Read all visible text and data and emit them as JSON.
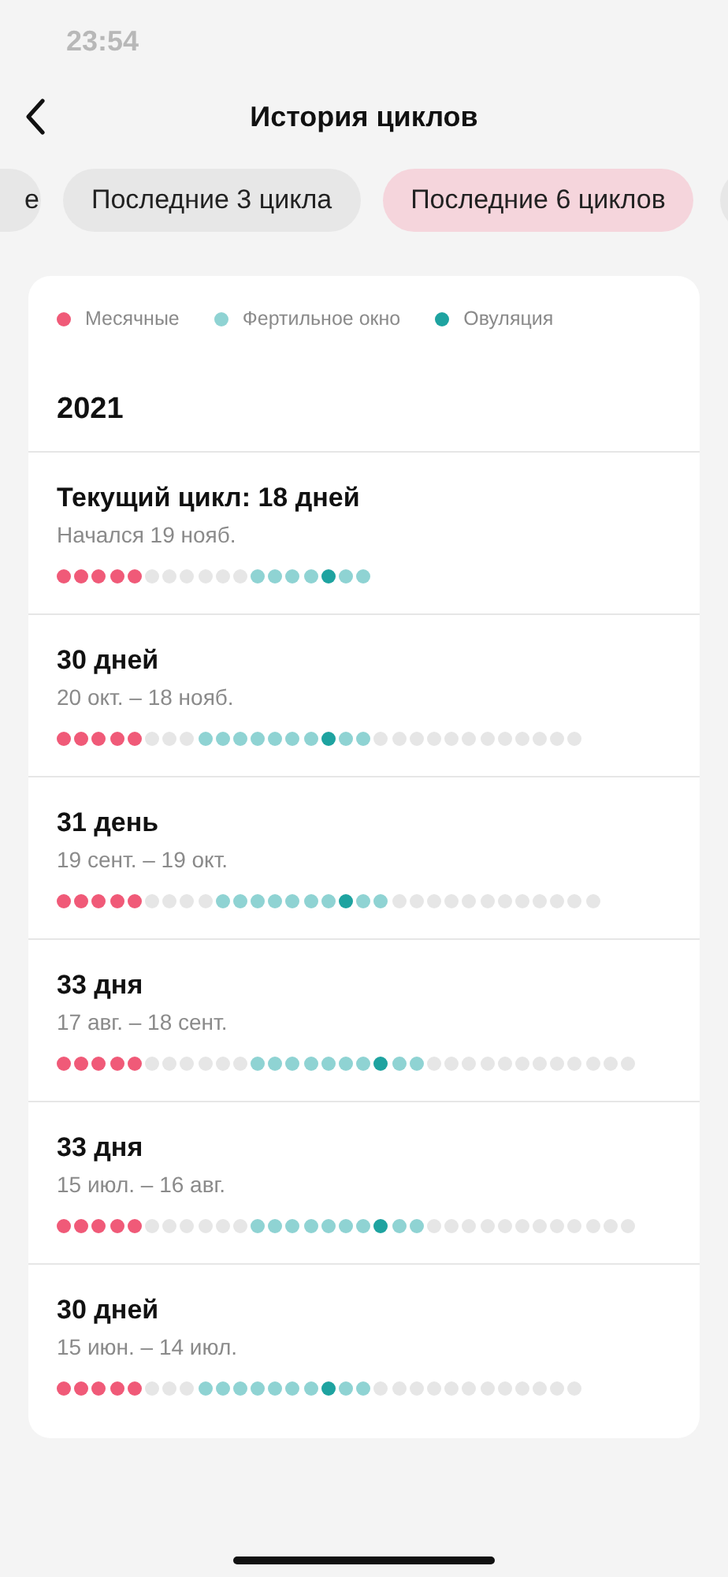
{
  "status_bar": {
    "time": "23:54"
  },
  "header": {
    "title": "История циклов"
  },
  "filters": [
    {
      "label": "е",
      "selected": false
    },
    {
      "label": "Последние 3 цикла",
      "selected": false
    },
    {
      "label": "Последние 6 циклов",
      "selected": true
    }
  ],
  "legend": [
    {
      "label": "Месячные",
      "color": "#f05a78"
    },
    {
      "label": "Фертильное окно",
      "color": "#8fd3d3"
    },
    {
      "label": "Овуляция",
      "color": "#1ea3a0"
    }
  ],
  "year": "2021",
  "cycles": [
    {
      "title": "Текущий цикл: 18 дней",
      "dates": "Начался 19 нояб.",
      "days": [
        {
          "kind": "period"
        },
        {
          "kind": "period"
        },
        {
          "kind": "period"
        },
        {
          "kind": "period"
        },
        {
          "kind": "period"
        },
        {
          "kind": "none"
        },
        {
          "kind": "none"
        },
        {
          "kind": "none"
        },
        {
          "kind": "none"
        },
        {
          "kind": "none"
        },
        {
          "kind": "none"
        },
        {
          "kind": "fertile"
        },
        {
          "kind": "fertile"
        },
        {
          "kind": "fertile"
        },
        {
          "kind": "fertile"
        },
        {
          "kind": "ovulation"
        },
        {
          "kind": "fertile"
        },
        {
          "kind": "fertile"
        }
      ]
    },
    {
      "title": "30 дней",
      "dates": "20 окт. – 18 нояб.",
      "days": [
        {
          "kind": "period"
        },
        {
          "kind": "period"
        },
        {
          "kind": "period"
        },
        {
          "kind": "period"
        },
        {
          "kind": "period"
        },
        {
          "kind": "none"
        },
        {
          "kind": "none"
        },
        {
          "kind": "none"
        },
        {
          "kind": "fertile"
        },
        {
          "kind": "fertile"
        },
        {
          "kind": "fertile"
        },
        {
          "kind": "fertile"
        },
        {
          "kind": "fertile"
        },
        {
          "kind": "fertile"
        },
        {
          "kind": "fertile"
        },
        {
          "kind": "ovulation"
        },
        {
          "kind": "fertile"
        },
        {
          "kind": "fertile"
        },
        {
          "kind": "none"
        },
        {
          "kind": "none"
        },
        {
          "kind": "none"
        },
        {
          "kind": "none"
        },
        {
          "kind": "none"
        },
        {
          "kind": "none"
        },
        {
          "kind": "none"
        },
        {
          "kind": "none"
        },
        {
          "kind": "none"
        },
        {
          "kind": "none"
        },
        {
          "kind": "none"
        },
        {
          "kind": "none"
        }
      ]
    },
    {
      "title": "31 день",
      "dates": "19 сент. – 19 окт.",
      "days": [
        {
          "kind": "period"
        },
        {
          "kind": "period"
        },
        {
          "kind": "period"
        },
        {
          "kind": "period"
        },
        {
          "kind": "period"
        },
        {
          "kind": "none"
        },
        {
          "kind": "none"
        },
        {
          "kind": "none"
        },
        {
          "kind": "none"
        },
        {
          "kind": "fertile"
        },
        {
          "kind": "fertile"
        },
        {
          "kind": "fertile"
        },
        {
          "kind": "fertile"
        },
        {
          "kind": "fertile"
        },
        {
          "kind": "fertile"
        },
        {
          "kind": "fertile"
        },
        {
          "kind": "ovulation"
        },
        {
          "kind": "fertile"
        },
        {
          "kind": "fertile"
        },
        {
          "kind": "none"
        },
        {
          "kind": "none"
        },
        {
          "kind": "none"
        },
        {
          "kind": "none"
        },
        {
          "kind": "none"
        },
        {
          "kind": "none"
        },
        {
          "kind": "none"
        },
        {
          "kind": "none"
        },
        {
          "kind": "none"
        },
        {
          "kind": "none"
        },
        {
          "kind": "none"
        },
        {
          "kind": "none"
        }
      ]
    },
    {
      "title": "33 дня",
      "dates": "17 авг. – 18 сент.",
      "days": [
        {
          "kind": "period"
        },
        {
          "kind": "period"
        },
        {
          "kind": "period"
        },
        {
          "kind": "period"
        },
        {
          "kind": "period"
        },
        {
          "kind": "none"
        },
        {
          "kind": "none"
        },
        {
          "kind": "none"
        },
        {
          "kind": "none"
        },
        {
          "kind": "none"
        },
        {
          "kind": "none"
        },
        {
          "kind": "fertile"
        },
        {
          "kind": "fertile"
        },
        {
          "kind": "fertile"
        },
        {
          "kind": "fertile"
        },
        {
          "kind": "fertile"
        },
        {
          "kind": "fertile"
        },
        {
          "kind": "fertile"
        },
        {
          "kind": "ovulation"
        },
        {
          "kind": "fertile"
        },
        {
          "kind": "fertile"
        },
        {
          "kind": "none"
        },
        {
          "kind": "none"
        },
        {
          "kind": "none"
        },
        {
          "kind": "none"
        },
        {
          "kind": "none"
        },
        {
          "kind": "none"
        },
        {
          "kind": "none"
        },
        {
          "kind": "none"
        },
        {
          "kind": "none"
        },
        {
          "kind": "none"
        },
        {
          "kind": "none"
        },
        {
          "kind": "none"
        }
      ]
    },
    {
      "title": "33 дня",
      "dates": "15 июл. – 16 авг.",
      "days": [
        {
          "kind": "period"
        },
        {
          "kind": "period"
        },
        {
          "kind": "period"
        },
        {
          "kind": "period"
        },
        {
          "kind": "period"
        },
        {
          "kind": "none"
        },
        {
          "kind": "none"
        },
        {
          "kind": "none"
        },
        {
          "kind": "none"
        },
        {
          "kind": "none"
        },
        {
          "kind": "none"
        },
        {
          "kind": "fertile"
        },
        {
          "kind": "fertile"
        },
        {
          "kind": "fertile"
        },
        {
          "kind": "fertile"
        },
        {
          "kind": "fertile"
        },
        {
          "kind": "fertile"
        },
        {
          "kind": "fertile"
        },
        {
          "kind": "ovulation"
        },
        {
          "kind": "fertile"
        },
        {
          "kind": "fertile"
        },
        {
          "kind": "none"
        },
        {
          "kind": "none"
        },
        {
          "kind": "none"
        },
        {
          "kind": "none"
        },
        {
          "kind": "none"
        },
        {
          "kind": "none"
        },
        {
          "kind": "none"
        },
        {
          "kind": "none"
        },
        {
          "kind": "none"
        },
        {
          "kind": "none"
        },
        {
          "kind": "none"
        },
        {
          "kind": "none"
        }
      ]
    },
    {
      "title": "30 дней",
      "dates": "15 июн. – 14 июл.",
      "days": [
        {
          "kind": "period"
        },
        {
          "kind": "period"
        },
        {
          "kind": "period"
        },
        {
          "kind": "period"
        },
        {
          "kind": "period"
        },
        {
          "kind": "none"
        },
        {
          "kind": "none"
        },
        {
          "kind": "none"
        },
        {
          "kind": "fertile"
        },
        {
          "kind": "fertile"
        },
        {
          "kind": "fertile"
        },
        {
          "kind": "fertile"
        },
        {
          "kind": "fertile"
        },
        {
          "kind": "fertile"
        },
        {
          "kind": "fertile"
        },
        {
          "kind": "ovulation"
        },
        {
          "kind": "fertile"
        },
        {
          "kind": "fertile"
        },
        {
          "kind": "none"
        },
        {
          "kind": "none"
        },
        {
          "kind": "none"
        },
        {
          "kind": "none"
        },
        {
          "kind": "none"
        },
        {
          "kind": "none"
        },
        {
          "kind": "none"
        },
        {
          "kind": "none"
        },
        {
          "kind": "none"
        },
        {
          "kind": "none"
        },
        {
          "kind": "none"
        },
        {
          "kind": "none"
        }
      ]
    }
  ]
}
